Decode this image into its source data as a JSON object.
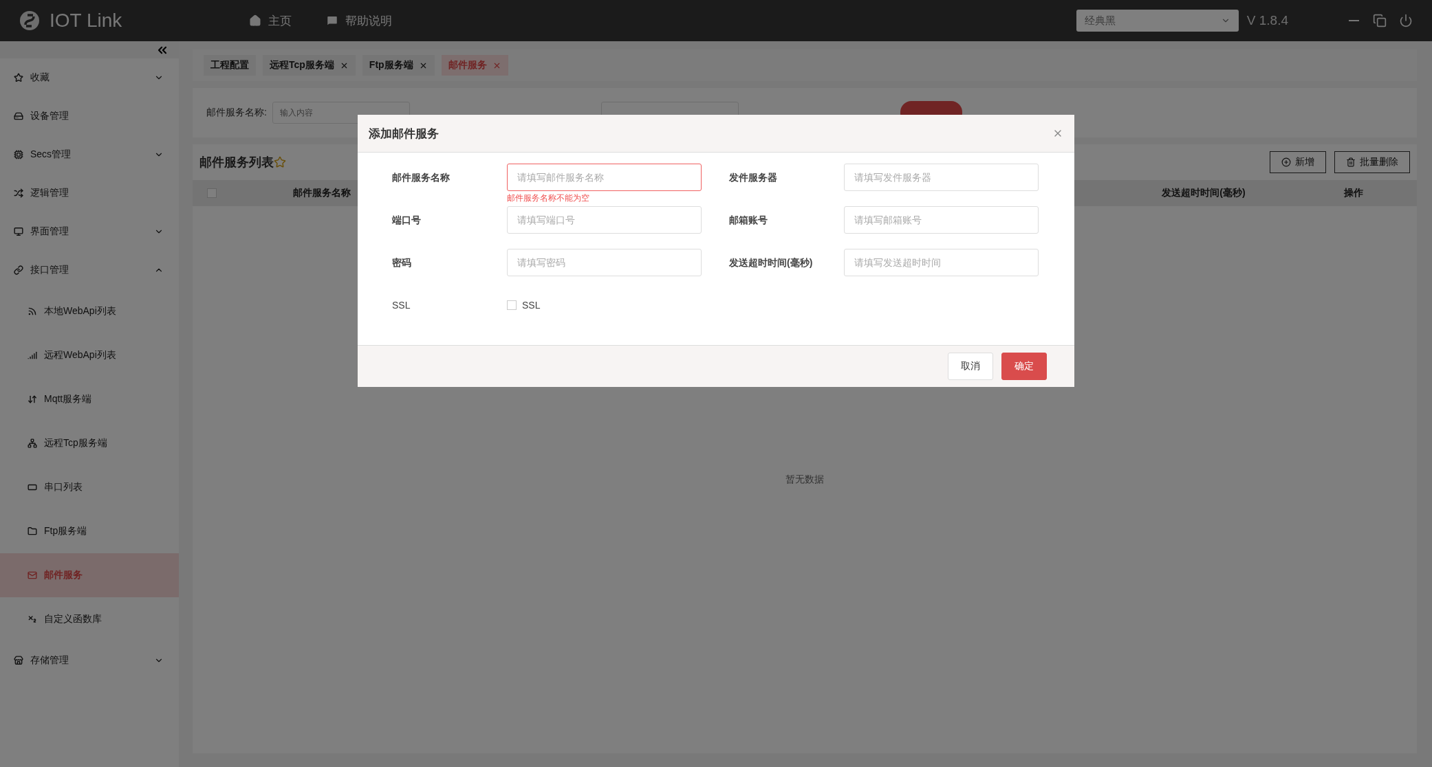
{
  "header": {
    "logo_text": "IOT Link",
    "nav": [
      {
        "label": "主页"
      },
      {
        "label": "帮助说明"
      }
    ],
    "theme_select": {
      "value": "经典黑"
    },
    "version": "V 1.8.4"
  },
  "sidebar": {
    "items": [
      {
        "label": "收藏",
        "expanded": false,
        "selected": false
      },
      {
        "label": "设备管理",
        "selected": false
      },
      {
        "label": "Secs管理",
        "expanded": false,
        "selected": false
      },
      {
        "label": "逻辑管理",
        "selected": false
      },
      {
        "label": "界面管理",
        "expanded": false,
        "selected": false
      },
      {
        "label": "接口管理",
        "expanded": true,
        "selected": false,
        "children": [
          {
            "label": "本地WebApi列表",
            "selected": false
          },
          {
            "label": "远程WebApi列表",
            "selected": false
          },
          {
            "label": "Mqtt服务端",
            "selected": false
          },
          {
            "label": "远程Tcp服务端",
            "selected": false
          },
          {
            "label": "串口列表",
            "selected": false
          },
          {
            "label": "Ftp服务端",
            "selected": false
          },
          {
            "label": "邮件服务",
            "selected": true
          },
          {
            "label": "自定义函数库",
            "selected": false
          }
        ]
      },
      {
        "label": "存储管理",
        "expanded": false,
        "selected": false
      }
    ]
  },
  "tabs": [
    {
      "label": "工程配置",
      "closable": false,
      "selected": false
    },
    {
      "label": "远程Tcp服务端",
      "closable": true,
      "selected": false
    },
    {
      "label": "Ftp服务端",
      "closable": true,
      "selected": false
    },
    {
      "label": "邮件服务",
      "closable": true,
      "selected": true
    }
  ],
  "search": {
    "fields": [
      {
        "label": "邮件服务名称:",
        "placeholder": "输入内容"
      }
    ]
  },
  "list": {
    "title": "邮件服务列表",
    "select_all_checked": false,
    "buttons": [
      "新增",
      "批量删除"
    ],
    "columns": [
      "邮件服务名称",
      "发送超时时间(毫秒)",
      "操作"
    ],
    "empty_text": "暂无数据"
  },
  "dialog": {
    "title": "添加邮件服务",
    "fields": [
      {
        "label": "邮件服务名称",
        "placeholder": "请填写邮件服务名称",
        "error": "邮件服务名称不能为空"
      },
      {
        "label": "发件服务器",
        "placeholder": "请填写发件服务器"
      },
      {
        "label": "端口号",
        "placeholder": "请填写端口号"
      },
      {
        "label": "邮箱账号",
        "placeholder": "请填写邮箱账号"
      },
      {
        "label": "密码",
        "placeholder": "请填写密码"
      },
      {
        "label": "发送超时时间(毫秒)",
        "placeholder": "请填写发送超时时间"
      }
    ],
    "ssl": {
      "label": "SSL",
      "checkbox_label": "SSL",
      "checked": false
    },
    "buttons": [
      {
        "label": "取消",
        "kind": "default"
      },
      {
        "label": "确定",
        "kind": "primary"
      }
    ]
  }
}
